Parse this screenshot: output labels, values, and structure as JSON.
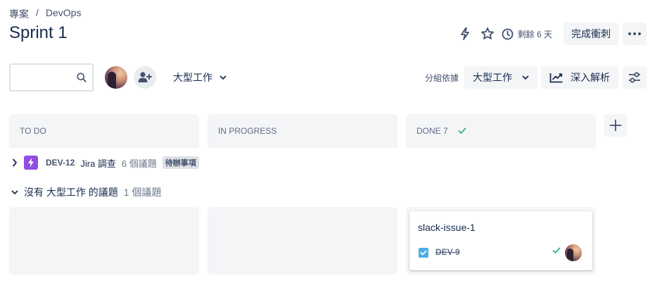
{
  "breadcrumb": {
    "project": "專案",
    "separator": "/",
    "current": "DevOps"
  },
  "page": {
    "title": "Sprint 1"
  },
  "header": {
    "days_left": "剩餘 6 天",
    "complete_label": "完成衝刺"
  },
  "toolbar": {
    "search": {
      "value": "",
      "placeholder": ""
    },
    "epic_filter_label": "大型工作",
    "group_by_label": "分組依據",
    "group_by_value": "大型工作",
    "insights_label": "深入解析"
  },
  "columns": [
    {
      "title": "TO DO"
    },
    {
      "title": "IN PROGRESS"
    },
    {
      "title": "DONE",
      "count": "7"
    }
  ],
  "epic": {
    "key": "DEV-12",
    "name": "Jira 調查",
    "count": "6 個議題",
    "status": "待辦事項"
  },
  "no_epic_group": {
    "label": "沒有 大型工作 的議題",
    "count": "1 個議題"
  },
  "card": {
    "title": "slack-issue-1",
    "key": "DEV-9"
  },
  "colors": {
    "epic": "#904ee2",
    "task": "#4bade8",
    "done_check": "#36b37e",
    "column_bg": "#f4f5f7"
  },
  "icons": {
    "automation": "lightning-icon",
    "star": "star-icon",
    "clock": "clock-icon",
    "more": "more-icon",
    "search": "search-icon",
    "add_person": "add-person-icon",
    "chart": "trend-icon",
    "settings": "sliders-icon",
    "add_column": "plus-icon"
  }
}
